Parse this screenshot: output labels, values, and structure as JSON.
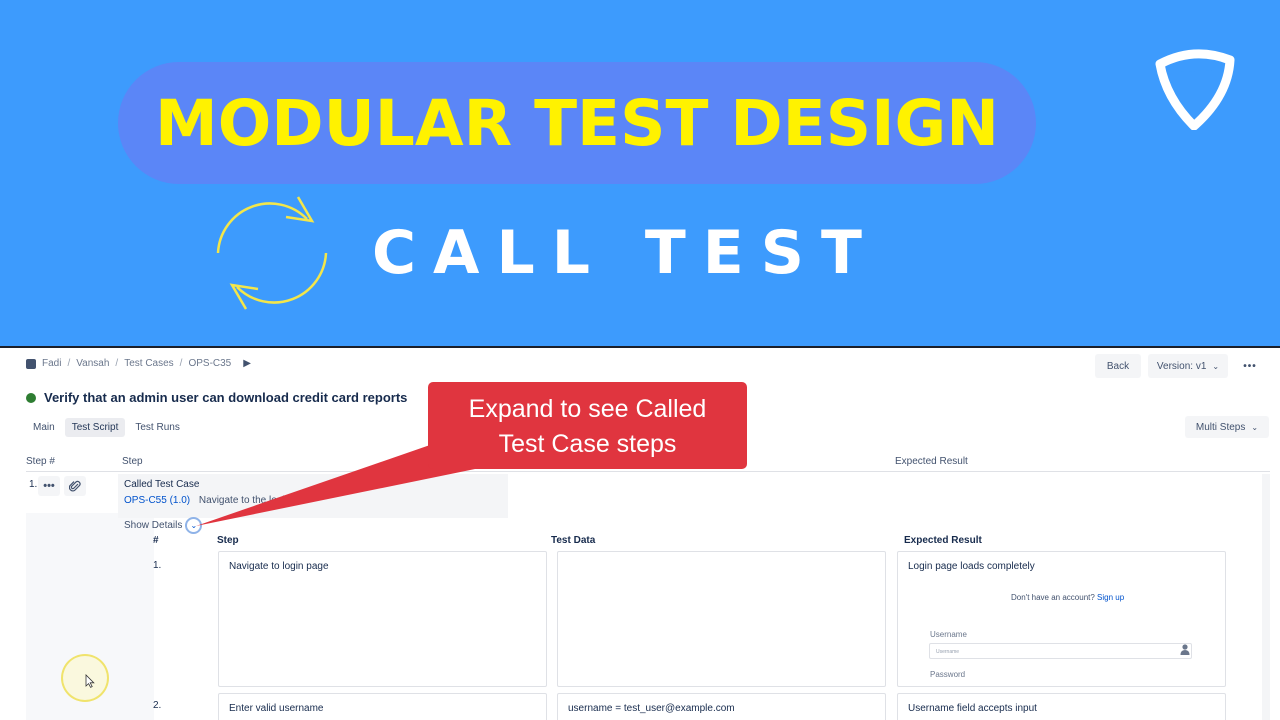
{
  "banner": {
    "title": "MODULAR TEST DESIGN",
    "subtitle": "CALL TEST",
    "bg_color": "#3d9bfd",
    "pill_color": "#5b86f7",
    "title_color": "#fff200"
  },
  "breadcrumb": [
    "Fadi",
    "Vansah",
    "Test Cases",
    "OPS-C35"
  ],
  "header": {
    "back_label": "Back",
    "version_label": "Version: v1",
    "more_label": "•••"
  },
  "test_case": {
    "title": "Verify that an admin user can download credit card reports",
    "status_color": "#2e7d32"
  },
  "tabs": [
    {
      "label": "Main",
      "active": false
    },
    {
      "label": "Test Script",
      "active": true
    },
    {
      "label": "Test Runs",
      "active": false
    }
  ],
  "multi_steps_label": "Multi Steps",
  "table": {
    "headers": {
      "step_num": "Step #",
      "step": "Step",
      "expected": "Expected Result"
    }
  },
  "row1": {
    "number": "1.",
    "more_label": "•••",
    "called_label": "Called Test Case",
    "ref_link": "OPS-C55 (1.0)",
    "ref_text": "Navigate to the login pa",
    "show_details": "Show Details"
  },
  "called_steps": {
    "headers": {
      "num": "#",
      "step": "Step",
      "data": "Test Data",
      "expected": "Expected Result"
    },
    "rows": [
      {
        "num": "1.",
        "step": "Navigate to login page",
        "data": "",
        "expected": "Login page loads completely"
      },
      {
        "num": "2.",
        "step": "Enter valid username",
        "data": "username = test_user@example.com",
        "expected": "Username field accepts input"
      }
    ],
    "preview": {
      "signup_text": "Don't have an account?",
      "signup_link": "Sign up",
      "username_label": "Username",
      "username_placeholder": "Username",
      "password_label": "Password"
    }
  },
  "callout": {
    "line1": "Expand to see Called",
    "line2": "Test Case steps",
    "color": "#e0353f"
  }
}
